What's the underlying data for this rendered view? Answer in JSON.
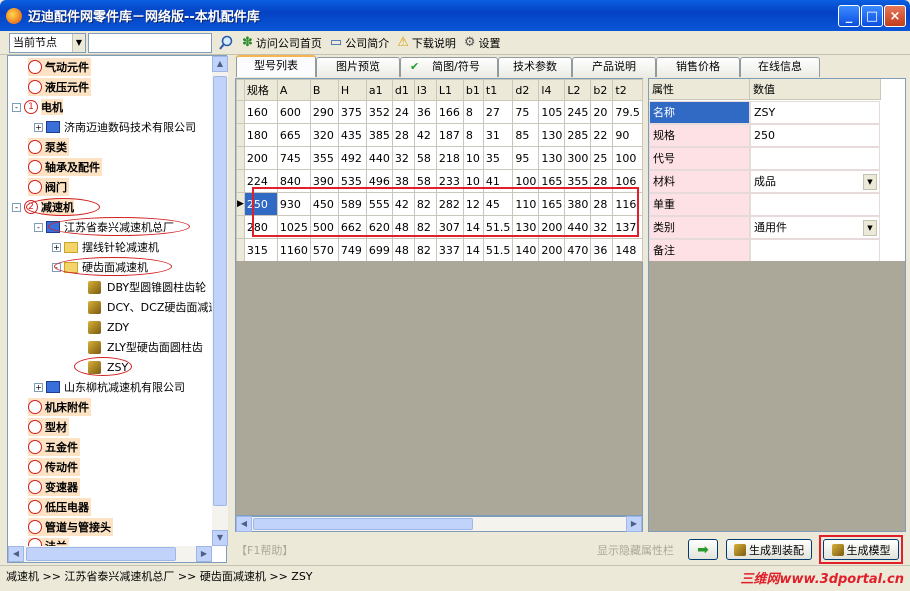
{
  "window": {
    "title": "迈迪配件网零件库－网络版--本机配件库",
    "min": "_",
    "max": "□",
    "close": "×"
  },
  "toolbar": {
    "node_select": "当前节点",
    "search_value": "",
    "visit_site": "访问公司首页",
    "company_intro": "公司简介",
    "download_help": "下载说明",
    "settings": "设置"
  },
  "tree": {
    "n0": "气动元件",
    "n1": "液压元件",
    "n2": "电机",
    "n2_num": "1",
    "n2_child": "济南迈迪数码技术有限公司",
    "n3": "泵类",
    "n4": "轴承及配件",
    "n5": "阀门",
    "n6": "减速机",
    "n6_num": "2",
    "n6_child": "江苏省泰兴减速机总厂",
    "n6_sub1": "摆线针轮减速机",
    "n6_sub2": "硬齿面减速机",
    "leaf1": "DBY型圆锥圆柱齿轮",
    "leaf2": "DCY、DCZ硬齿面减速",
    "leaf3": "ZDY",
    "leaf4": "ZLY型硬齿面圆柱齿",
    "leaf5": "ZSY",
    "n6_child2": "山东柳杭减速机有限公司",
    "n7": "机床附件",
    "n8": "型材",
    "n9": "五金件",
    "n10": "传动件",
    "n11": "变速器",
    "n12": "低压电器",
    "n13": "管道与管接头",
    "n14": "法兰"
  },
  "tabs": [
    "型号列表",
    "图片预览",
    "简图/符号",
    "技术参数",
    "产品说明",
    "销售价格",
    "在线信息"
  ],
  "table": {
    "columns": [
      "规格",
      "A",
      "B",
      "H",
      "a1",
      "d1",
      "l3",
      "L1",
      "b1",
      "t1",
      "d2",
      "l4",
      "L2",
      "b2",
      "t2"
    ],
    "rows": [
      [
        "160",
        "600",
        "290",
        "375",
        "352",
        "24",
        "36",
        "166",
        "8",
        "27",
        "75",
        "105",
        "245",
        "20",
        "79.5"
      ],
      [
        "180",
        "665",
        "320",
        "435",
        "385",
        "28",
        "42",
        "187",
        "8",
        "31",
        "85",
        "130",
        "285",
        "22",
        "90"
      ],
      [
        "200",
        "745",
        "355",
        "492",
        "440",
        "32",
        "58",
        "218",
        "10",
        "35",
        "95",
        "130",
        "300",
        "25",
        "100"
      ],
      [
        "224",
        "840",
        "390",
        "535",
        "496",
        "38",
        "58",
        "233",
        "10",
        "41",
        "100",
        "165",
        "355",
        "28",
        "106"
      ],
      [
        "250",
        "930",
        "450",
        "589",
        "555",
        "42",
        "82",
        "282",
        "12",
        "45",
        "110",
        "165",
        "380",
        "28",
        "116"
      ],
      [
        "280",
        "1025",
        "500",
        "662",
        "620",
        "48",
        "82",
        "307",
        "14",
        "51.5",
        "130",
        "200",
        "440",
        "32",
        "137"
      ],
      [
        "315",
        "1160",
        "570",
        "749",
        "699",
        "48",
        "82",
        "337",
        "14",
        "51.5",
        "140",
        "200",
        "470",
        "36",
        "148"
      ]
    ],
    "current_row_marker": "▶"
  },
  "props": {
    "header_name": "属性",
    "header_value": "数值",
    "rows": [
      {
        "name": "名称",
        "value": "ZSY"
      },
      {
        "name": "规格",
        "value": "250"
      },
      {
        "name": "代号",
        "value": ""
      },
      {
        "name": "材料",
        "value": "成品"
      },
      {
        "name": "单重",
        "value": ""
      },
      {
        "name": "类别",
        "value": "通用件"
      },
      {
        "name": "备注",
        "value": ""
      }
    ]
  },
  "bottom": {
    "f1_help": "【F1帮助】",
    "show_hidden": "显示隐藏属性栏",
    "gen_assembly": "生成到装配",
    "gen_model": "生成模型"
  },
  "status": {
    "path": "减速机 >> 江苏省泰兴减速机总厂 >> 硬齿面减速机 >> ZSY",
    "watermark": "三维网www.3dportal.cn"
  }
}
